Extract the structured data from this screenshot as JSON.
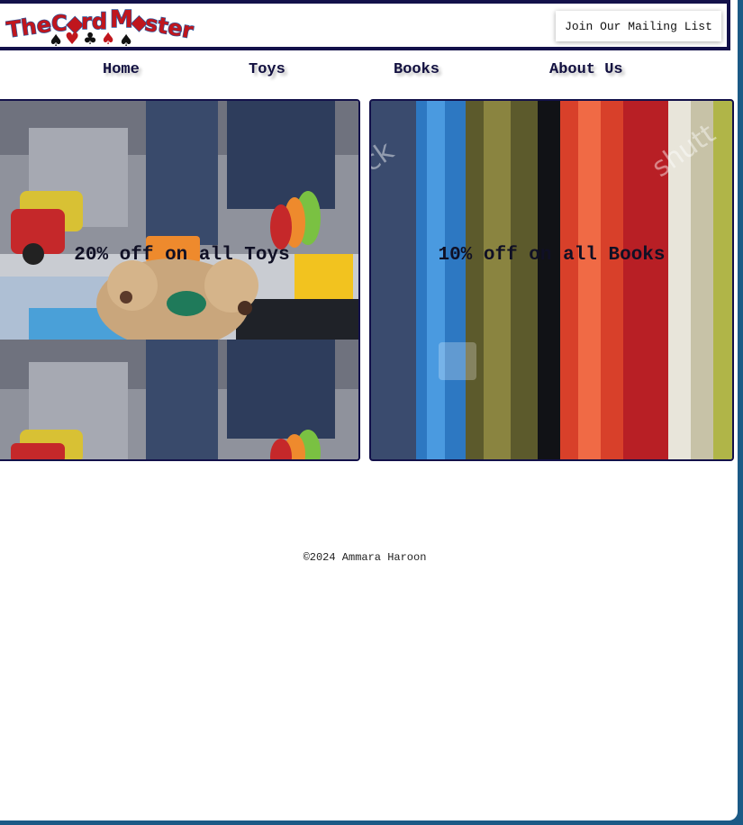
{
  "brand": {
    "logo_text": "The Card Master",
    "logo_colors": {
      "red": "#c0161d",
      "blue": "#2a5aa0",
      "black": "#111111"
    }
  },
  "header": {
    "mailing_list_button": "Join Our Mailing List"
  },
  "nav": {
    "items": [
      {
        "label": "Home"
      },
      {
        "label": "Toys"
      },
      {
        "label": "Books"
      },
      {
        "label": "About Us"
      }
    ]
  },
  "promos": [
    {
      "caption": "20% off on all Toys",
      "image": "toys-playroom-photo"
    },
    {
      "caption": "10% off on all Books",
      "image": "book-spines-photo"
    }
  ],
  "footer": {
    "copyright": "©2024 Ammara Haroon"
  },
  "colors": {
    "navy": "#13114a",
    "frame": "#1b5a86",
    "background": "#ffffff"
  }
}
